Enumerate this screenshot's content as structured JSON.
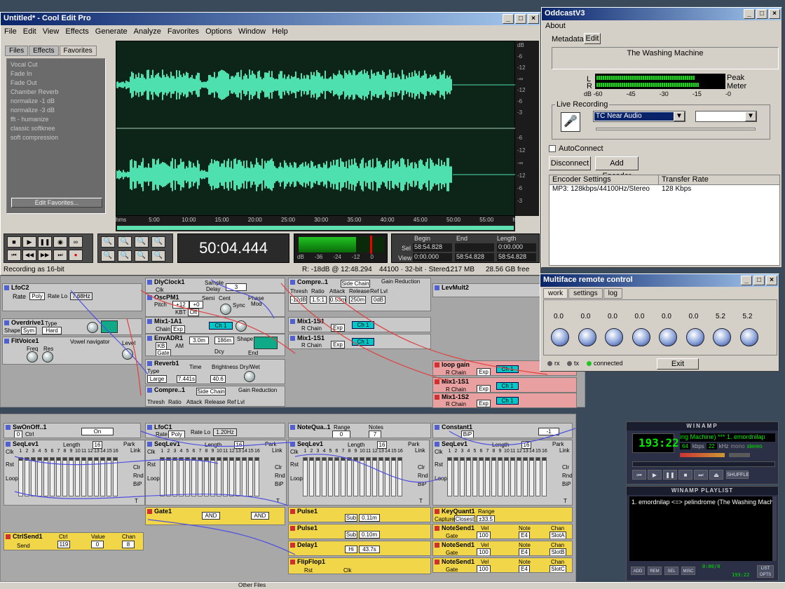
{
  "cooledit": {
    "title": "Untitled* - Cool Edit Pro",
    "menu": [
      "File",
      "Edit",
      "View",
      "Effects",
      "Generate",
      "Analyze",
      "Favorites",
      "Options",
      "Window",
      "Help"
    ],
    "tabs": [
      "Files",
      "Effects",
      "Favorites"
    ],
    "favorites": [
      "Vocal Cut",
      "Fade In",
      "Fade Out",
      "Chamber Reverb",
      "normalize -1 dB",
      "normalize -3 dB",
      "fft - humanize",
      "classic softknee",
      "soft compression"
    ],
    "edit_favorites": "Edit Favorites...",
    "time_ruler": [
      "hms",
      "5:00",
      "10:00",
      "15:00",
      "20:00",
      "25:00",
      "30:00",
      "35:00",
      "40:00",
      "45:00",
      "50:00",
      "55:00",
      "hms"
    ],
    "db_scale_top": [
      "dB",
      "-6",
      "-12",
      "-∞",
      "-12",
      "-6",
      "-3"
    ],
    "db_scale_bot": [
      "-6",
      "-12",
      "-∞",
      "-12",
      "-6",
      "-3"
    ],
    "time_display": "50:04.444",
    "meter_scale": [
      "dB",
      "-36",
      "-24",
      "-12",
      "0"
    ],
    "sel_headers": {
      "begin": "Begin",
      "end": "End",
      "length": "Length"
    },
    "sel_label": "Sel",
    "view_label": "View",
    "sel": {
      "begin": "58:54.828",
      "end": "",
      "length": "0:00.000"
    },
    "view": {
      "begin": "0:00.000",
      "end": "58:54.828",
      "length": "58:54.828"
    },
    "status": {
      "recording": "Recording as 16-bit",
      "level": "R: -18dB @ 12:48.294",
      "format": "44100 · 32-bit · Stereo",
      "size": "1217 MB",
      "free": "28.56 GB free"
    }
  },
  "oddcast": {
    "title": "OddcastV3",
    "menu": "About",
    "metadata_label": "Metadata",
    "edit_button": "Edit",
    "now_playing": "The Washing Machine",
    "meter_labels": {
      "l": "L",
      "r": "R",
      "peak": "Peak",
      "meter": "Meter"
    },
    "meter_scale": [
      "dB -60",
      "-45",
      "-30",
      "-15",
      "-0"
    ],
    "live_recording": "Live Recording",
    "device": "TC Near Audio",
    "autoconnect": "AutoConnect",
    "disconnect": "Disconnect",
    "add_encoder": "Add Encoder",
    "col_settings": "Encoder Settings",
    "col_rate": "Transfer Rate",
    "row_settings": "MP3: 128kbps/44100Hz/Stereo",
    "row_rate": "128 Kbps"
  },
  "multiface": {
    "title": "Multiface remote control",
    "tabs": [
      "work",
      "settings",
      "log"
    ],
    "knob_values": [
      "0.0",
      "0.0",
      "0.0",
      "0.0",
      "0.0",
      "0.0",
      "5.2",
      "5.2"
    ],
    "status_rx": "rx",
    "status_tx": "tx",
    "status_connected": "connected",
    "exit": "Exit"
  },
  "winamp": {
    "title": "WINAMP",
    "time": "193:22",
    "scroll": "ing Machine) *** 1. emordnilap",
    "kbps": "64",
    "khz": "22",
    "kbps_label": "kbps",
    "khz_label": "kHz",
    "mono": "mono",
    "stereo": "stereo",
    "shuffle": "SHUFFLE",
    "playlist_title": "WINAMP PLAYLIST",
    "playlist_item": "1. emordnilap <=> pelindrome (The Washing Mach...",
    "pl_buttons": [
      "ADD",
      "REM",
      "SEL",
      "MISC"
    ],
    "pl_time": "0:00/0",
    "pl_small_time": "193:22",
    "list_opts": "LIST OPTS"
  },
  "reaktor": {
    "lfoc2": {
      "name": "LfoC2",
      "rate": "Rate",
      "mode": "Poly",
      "rate_lo": "Rate Lo",
      "freq": "7.68Hz"
    },
    "overdrive": {
      "name": "Overdrive1",
      "shape": "Shape",
      "sym": "Sym",
      "type": "Type",
      "hard": "Hard"
    },
    "fltvoice": {
      "name": "FltVoice1",
      "freq": "Freq",
      "res": "Res",
      "vowel": "Vowel navigator",
      "level": "Level"
    },
    "dlyclock": {
      "name": "DlyClock1",
      "clk": "Clk",
      "sample": "Sample",
      "delay": "Delay",
      "val": "3"
    },
    "oscpm": {
      "name": "OscPM1",
      "pitch": "Pitch",
      "semi": "Semi",
      "cent": "Cent",
      "pval": "+12",
      "cval": "+0",
      "kbt": "KBT",
      "off": "Off",
      "sync": "Sync",
      "phase": "Phase",
      "mod": "Mod"
    },
    "mix1a1": {
      "name": "Mix1-1A1",
      "chain": "Chain",
      "exp": "Exp",
      "ch": "Ch 1"
    },
    "envadr": {
      "name": "EnvADR1",
      "kb": "KB",
      "gate": "Gate",
      "am": "AM",
      "a": "3.0m",
      "d": "186m",
      "shape": "Shape",
      "dcy": "Dcy",
      "end": "End"
    },
    "reverb": {
      "name": "Reverb1",
      "type": "Type",
      "large": "Large",
      "time": "Time",
      "brightness": "Brightness",
      "drywet": "Dry/Wet",
      "tval": "7.441s",
      "bval": "40.6"
    },
    "compre_a": {
      "name": "Compre..1",
      "side": "Side Chain",
      "gr": "Gain Reduction",
      "thresh": "Thresh",
      "ratio": "Ratio",
      "attack": "Attack",
      "release": "Release",
      "ref": "Ref Lvl",
      "tv": "-12dB",
      "rv": "1.5:1",
      "av": "0.53m",
      "relv": "250m",
      "refv": "0dB"
    },
    "compre_b": {
      "name": "Compre..1",
      "side": "Side Chain",
      "gr": "Gain Reduction",
      "thresh": "Thresh",
      "ratio": "Ratio",
      "attack": "Attack",
      "release": "Release",
      "ref": "Ref Lvl"
    },
    "mix1s1a": {
      "name": "Mix1-1S1",
      "chain": "R Chain",
      "exp": "Exp",
      "ch": "Ch 1"
    },
    "mix1s1b": {
      "name": "Mix1-1S1",
      "chain": "R Chain",
      "exp": "Exp",
      "ch": "Ch 1"
    },
    "levmult": {
      "name": "LevMult2"
    },
    "loopgain": {
      "name": "loop gain",
      "chain": "R Chain",
      "exp": "Exp",
      "ch": "Ch 1"
    },
    "mix1s1c": {
      "name": "Mix1-1S1",
      "chain": "R Chain",
      "exp": "Exp",
      "ch": "Ch 1"
    },
    "mix1s2": {
      "name": "Mix1-1S2",
      "chain": "R Chain",
      "exp": "Exp",
      "ch": "Ch 1"
    },
    "swonoff": {
      "name": "SwOnOff..1",
      "val": "0",
      "ctrl": "Ctrl",
      "on": "On"
    },
    "lfoc1": {
      "name": "LfoC1",
      "rate": "Rate",
      "mode": "Poly",
      "rate_lo": "Rate Lo",
      "freq": "1.20Hz"
    },
    "notequa": {
      "name": "NoteQua..1",
      "range": "Range",
      "notes": "Notes",
      "rv": "0",
      "nv": "7"
    },
    "constant": {
      "name": "Constant1",
      "bip": "BiP",
      "val": "-1"
    },
    "seq": {
      "name": "SeqLev1",
      "length": "Length",
      "lval": "16",
      "park": "Park",
      "link": "Link",
      "clk": "Clk",
      "rst": "Rst",
      "loop": "Loop",
      "clr": "Clr",
      "rnd": "Rnd",
      "bip": "BiP",
      "t": "T",
      "steps": [
        "1",
        "2",
        "3",
        "4",
        "5",
        "6",
        "7",
        "8",
        "9",
        "10",
        "11",
        "12",
        "13",
        "14",
        "15",
        "16"
      ]
    },
    "gate1": {
      "name": "Gate1",
      "and1": "AND",
      "and2": "AND"
    },
    "pulse1": {
      "name": "Pulse1",
      "sub": "Sub",
      "val": "0.11m"
    },
    "pulse2": {
      "name": "Pulse1",
      "sub": "Sub",
      "val": "0.10m"
    },
    "delay1": {
      "name": "Delay1",
      "hi": "Hi",
      "val": "43.7s"
    },
    "flipflop": {
      "name": "FlipFlop1",
      "rst": "Rst",
      "clk": "Clk"
    },
    "keyquant": {
      "name": "KeyQuant1",
      "range": "Range",
      "capture": "Capture",
      "closest": "Closest",
      "val": "±33.5"
    },
    "notesend1": {
      "name": "NoteSend1",
      "vel": "Vel",
      "note": "Note",
      "chan": "Chan",
      "gate": "Gate",
      "vv": "100",
      "nv": "E4",
      "cv": "SlotA"
    },
    "notesend2": {
      "name": "NoteSend1",
      "vel": "Vel",
      "note": "Note",
      "chan": "Chan",
      "gate": "Gate",
      "vv": "100",
      "nv": "E4",
      "cv": "SlotB"
    },
    "notesend3": {
      "name": "NoteSend1",
      "vel": "Vel",
      "note": "Note",
      "chan": "Chan",
      "gate": "Gate",
      "vv": "100",
      "nv": "E4",
      "cv": "SlotC"
    },
    "ctrlsend": {
      "name": "CtrlSend1",
      "ctrl": "Ctrl",
      "value": "Value",
      "chan": "Chan",
      "send": "Send",
      "cv": "119",
      "vv": "0",
      "chv": "8"
    }
  },
  "taskbar": {
    "other_files": "Other Files"
  },
  "colors": {
    "wave": "#4fe0b0",
    "wave_bg": "#0d2418",
    "meter_green": "#22c422",
    "time_text": "#ffffff",
    "winamp_lcd": "#00e800"
  }
}
